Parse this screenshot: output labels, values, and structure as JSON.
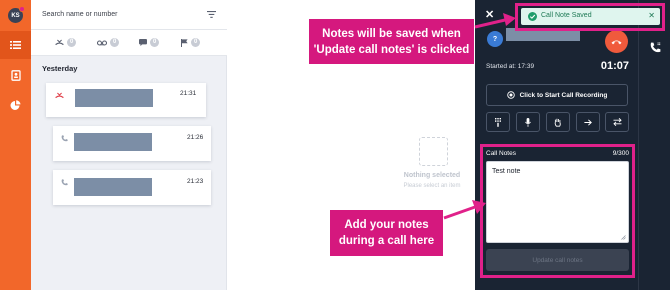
{
  "nav": {
    "avatar_initials": "KS",
    "items": [
      {
        "icon": "list-icon",
        "active": true
      },
      {
        "icon": "contacts-book-icon",
        "active": false
      },
      {
        "icon": "chart-pie-icon",
        "active": false
      }
    ]
  },
  "search": {
    "placeholder": "Search name or number",
    "filter_icon": "filter-lines-icon"
  },
  "filters": [
    {
      "icon": "missed-call-icon",
      "count": "0"
    },
    {
      "icon": "voicemail-icon",
      "count": "0"
    },
    {
      "icon": "message-icon",
      "count": "0"
    },
    {
      "icon": "flag-icon",
      "count": "0"
    }
  ],
  "history": {
    "section": "Yesterday",
    "items": [
      {
        "time": "21:31",
        "icon": "missed-call-icon"
      },
      {
        "time": "21:26",
        "icon": "phone-icon"
      },
      {
        "time": "21:23",
        "icon": "phone-icon"
      }
    ]
  },
  "empty": {
    "title": "Nothing selected",
    "subtitle": "Please select an item"
  },
  "call": {
    "caller_initial": "?",
    "started_label": "Started at: 17:39",
    "duration": "01:07",
    "record_label": "Click to Start Call Recording",
    "notes_label": "Call Notes",
    "notes_count": "9/300",
    "notes_text": "Test note",
    "update_label": "Update call notes"
  },
  "toast": {
    "text": "Call Note Saved"
  },
  "annotations": {
    "top": "Notes will be saved when 'Update call notes' is clicked",
    "bottom": "Add your notes during a call here"
  },
  "colors": {
    "accent": "#f2672a",
    "panel": "#1a2433",
    "highlight": "#e0218a",
    "success": "#1f9d6b"
  }
}
